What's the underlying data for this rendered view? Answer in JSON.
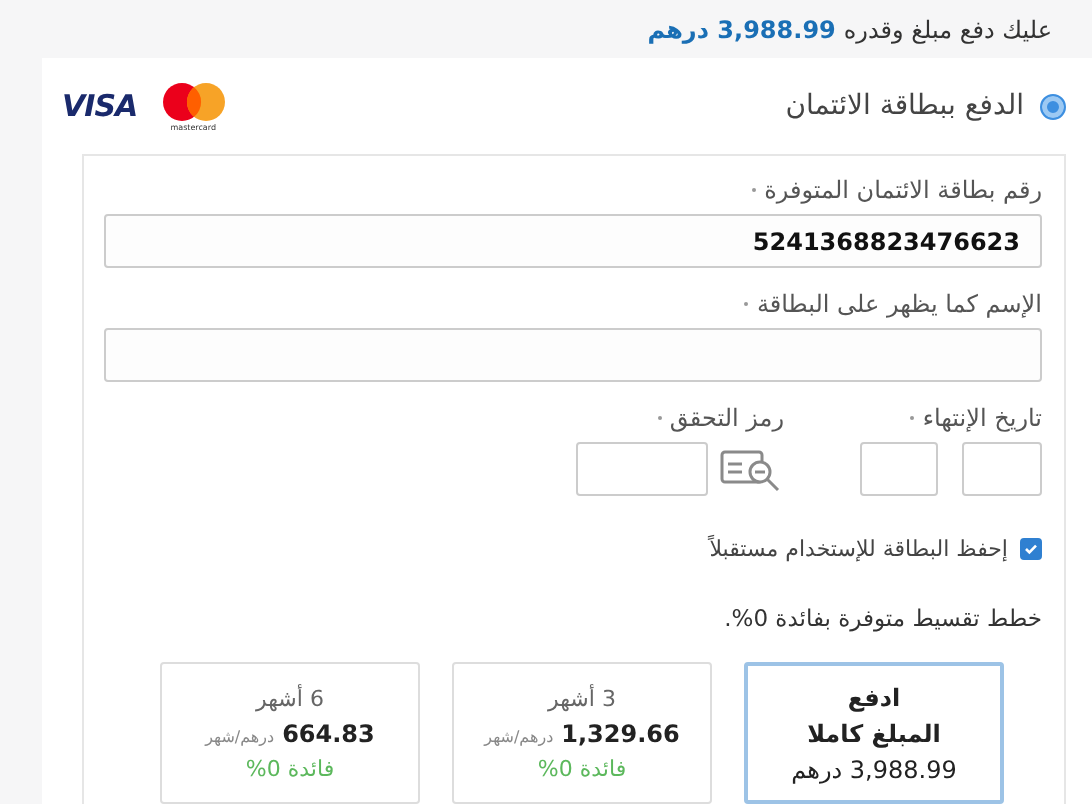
{
  "notice": {
    "text": "عليك دفع مبلغ وقدره",
    "amount": "3,988.99 درهم"
  },
  "payment_method": {
    "label": "الدفع ببطاقة الائتمان",
    "selected": true
  },
  "card_brands": [
    {
      "kind": "visa",
      "label": "VISA"
    },
    {
      "kind": "mastercard",
      "label": "mastercard"
    }
  ],
  "fields": [
    {
      "label": "رقم بطاقة الائتمان المتوفرة",
      "value": "5241368823476623",
      "required": true
    },
    {
      "label": "الإسم كما يظهر على البطاقة",
      "required": true
    }
  ],
  "expiry": {
    "label": "تاريخ الإنتهاء",
    "required": true
  },
  "cvv": {
    "label": "رمز التحقق",
    "required": true
  },
  "save_card": {
    "label": "إحفظ البطاقة للإستخدام مستقبلاً",
    "checked": true
  },
  "installments": {
    "heading": "خطط تقسيط متوفرة بفائدة 0%.",
    "plans": [
      {
        "kind": "full",
        "selected": true,
        "line_1": "ادفع",
        "line_2": "المبلغ كاملا",
        "amount": "3,988.99 درهم"
      },
      {
        "kind": "monthly",
        "selected": false,
        "title": "3 أشهر",
        "amount": "1,329.66",
        "unit": "درهم/شهر",
        "interest": "فائدة 0%"
      },
      {
        "kind": "monthly",
        "selected": false,
        "title": "6 أشهر",
        "amount": "664.83",
        "unit": "درهم/شهر",
        "interest": "فائدة 0%"
      }
    ]
  }
}
